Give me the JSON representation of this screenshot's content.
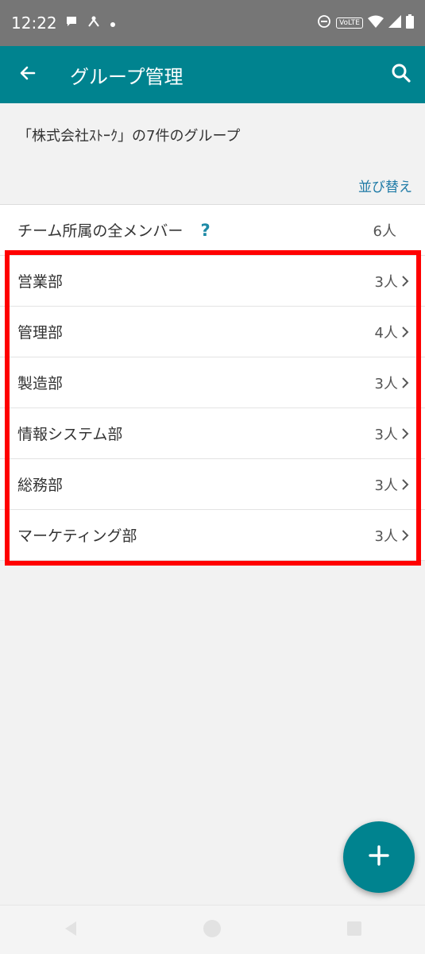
{
  "status_bar": {
    "time": "12:22",
    "volte": "VoLTE",
    "icons": [
      "chat-bubble-icon",
      "network-share-icon",
      "dot-icon",
      "dnd-icon",
      "wifi-icon",
      "signal-icon",
      "battery-icon"
    ]
  },
  "app_bar": {
    "title": "グループ管理",
    "color": "#00838f"
  },
  "header_text": "「株式会社ｽﾄｰｸ」の7件のグループ",
  "sort_label": "並び替え",
  "all_members": {
    "label": "チーム所属の全メンバー",
    "help": "?",
    "count": "6人"
  },
  "groups": [
    {
      "name": "営業部",
      "count": "3人"
    },
    {
      "name": "管理部",
      "count": "4人"
    },
    {
      "name": "製造部",
      "count": "3人"
    },
    {
      "name": "情報システム部",
      "count": "3人"
    },
    {
      "name": "総務部",
      "count": "3人"
    },
    {
      "name": "マーケティング部",
      "count": "3人"
    }
  ],
  "highlight_color": "#ff0000"
}
